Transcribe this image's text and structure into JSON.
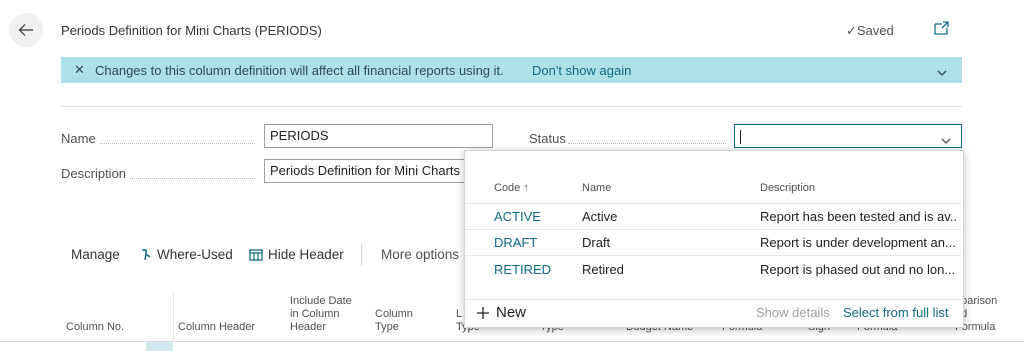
{
  "header": {
    "title": "Periods Definition for Mini Charts (PERIODS)",
    "saved_label": "Saved"
  },
  "banner": {
    "message": "Changes to this column definition will affect all financial reports using it.",
    "link": "Don't show again"
  },
  "fields": {
    "name_label": "Name",
    "name_value": "PERIODS",
    "description_label": "Description",
    "description_value": "Periods Definition for Mini Charts",
    "status_label": "Status",
    "status_value": ""
  },
  "dropdown": {
    "headers": {
      "code": "Code ↑",
      "name": "Name",
      "description": "Description"
    },
    "rows": [
      {
        "code": "ACTIVE",
        "name": "Active",
        "description": "Report has been tested and is av..."
      },
      {
        "code": "DRAFT",
        "name": "Draft",
        "description": "Report is under development an..."
      },
      {
        "code": "RETIRED",
        "name": "Retired",
        "description": "Report is phased out and no lon..."
      }
    ],
    "new_label": "New",
    "show_details": "Show details",
    "select_full_list": "Select from full list"
  },
  "actions": {
    "manage": "Manage",
    "where_used": "Where-Used",
    "hide_header": "Hide Header",
    "more_options": "More options"
  },
  "columns": {
    "column_no": "Column No.",
    "column_header": "Column Header",
    "include_date_1": "Include Date",
    "include_date_2": "in Column",
    "include_date_3": "Header",
    "column_type_1": "Column",
    "column_type_2": "Type",
    "ledger_type_1": "L",
    "ledger_type_2": "Type",
    "type": "Type",
    "budget_name": "Budget Name",
    "formula": "Formula",
    "sign": "Sign",
    "formula2": "Formula",
    "comparison_1": "nparison",
    "comparison_2": "od",
    "comparison_3": "Formula"
  },
  "colors": {
    "accent": "#0f6c86",
    "banner": "#aee0e8"
  }
}
